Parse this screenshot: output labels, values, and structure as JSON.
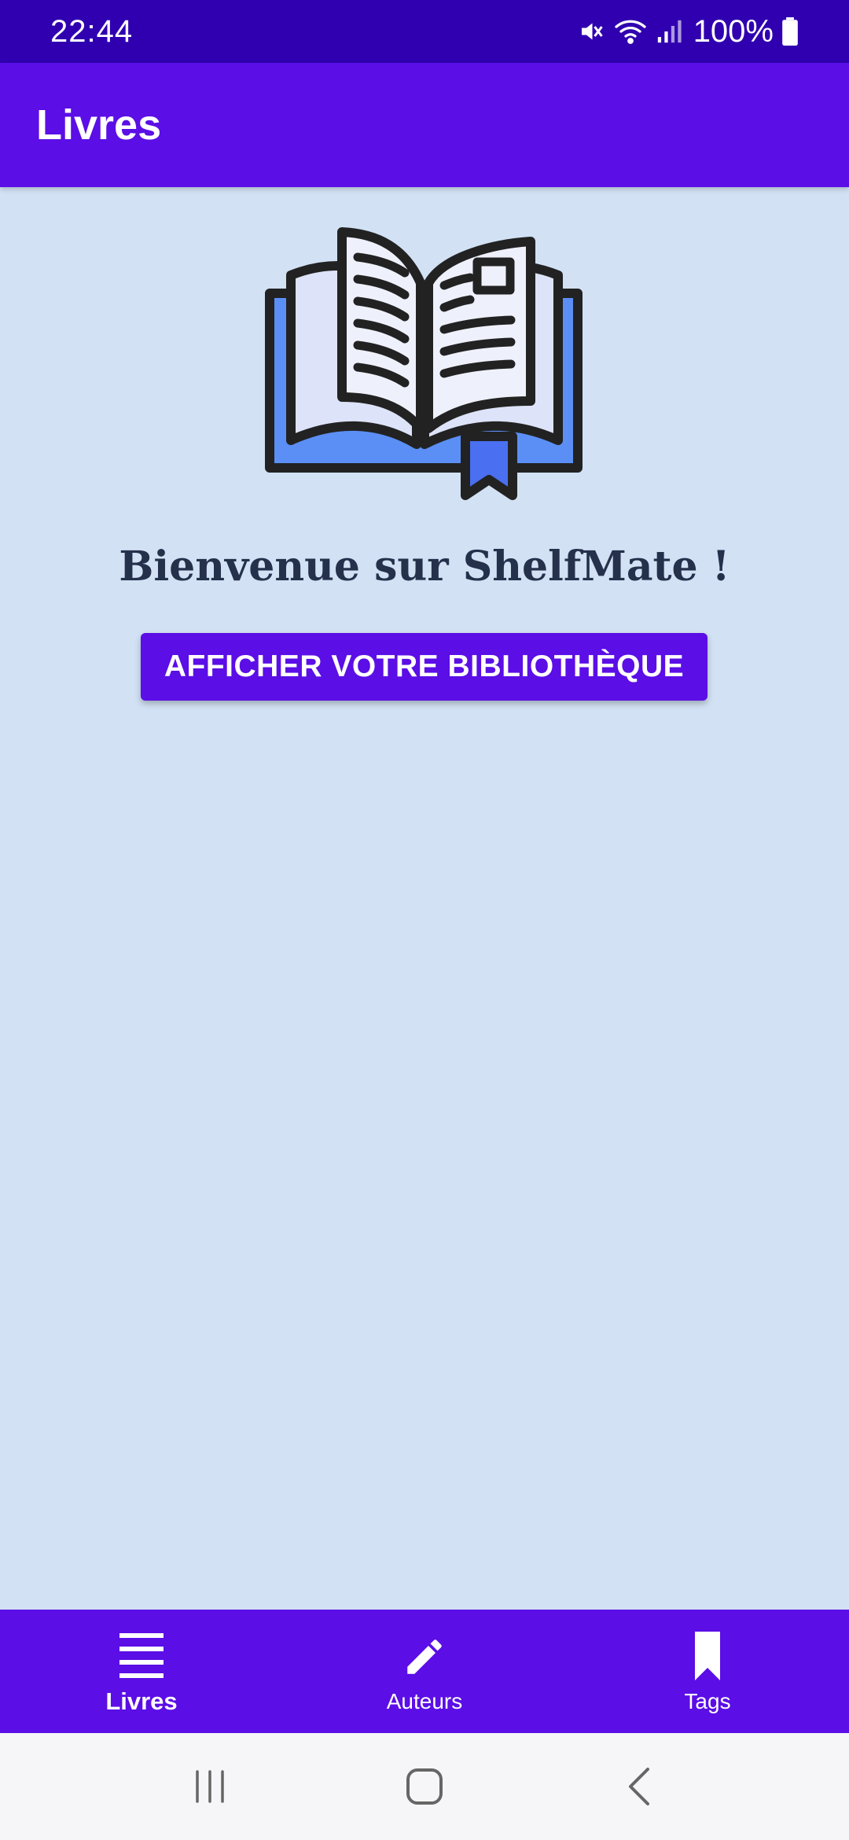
{
  "status_bar": {
    "time": "22:44",
    "battery": "100%",
    "icons": [
      "mute-icon",
      "wifi-icon",
      "signal-icon",
      "battery-icon"
    ]
  },
  "app_bar": {
    "title": "Livres"
  },
  "main": {
    "illustration_icon": "open-book-icon",
    "welcome_text": "Bienvenue sur ShelfMate !",
    "cta_label": "AFFICHER VOTRE BIBLIOTHÈQUE"
  },
  "bottom_nav": {
    "items": [
      {
        "label": "Livres",
        "icon": "menu-list-icon",
        "active": true
      },
      {
        "label": "Auteurs",
        "icon": "pencil-icon",
        "active": false
      },
      {
        "label": "Tags",
        "icon": "bookmark-icon",
        "active": false
      }
    ]
  },
  "system_nav": {
    "icons": [
      "recents-icon",
      "home-icon",
      "back-icon"
    ]
  },
  "colors": {
    "status_bar": "#3000b0",
    "primary": "#5b0ee6",
    "background": "#d2e1f4",
    "text_dark": "#25304b",
    "book_blue": "#5b8ff5",
    "book_pages": "#dde3f8"
  }
}
